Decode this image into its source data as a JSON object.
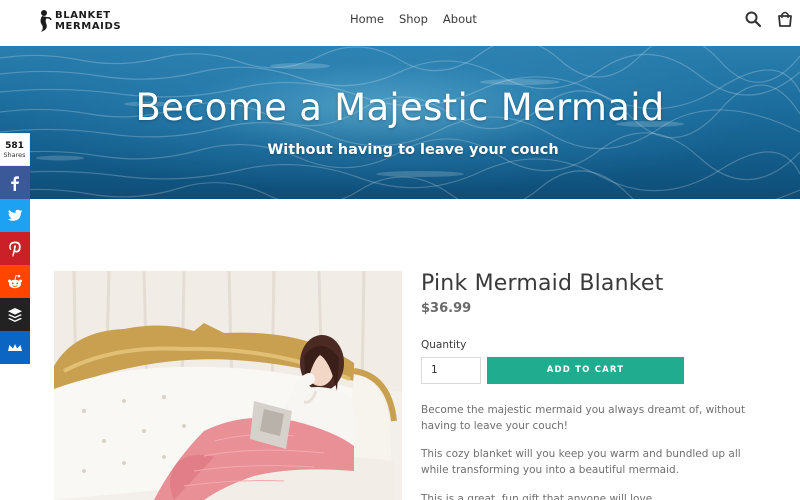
{
  "header": {
    "logo_line1": "BLANKET",
    "logo_line2": "MERMAIDS",
    "nav": [
      "Home",
      "Shop",
      "About"
    ],
    "icons": [
      "search-icon",
      "cart-icon"
    ]
  },
  "hero": {
    "title": "Become a Majestic Mermaid",
    "subtitle": "Without having to leave your couch"
  },
  "share": {
    "count": "581",
    "count_label": "Shares",
    "buttons": [
      {
        "name": "facebook",
        "icon": "facebook-icon",
        "color": "#3b5998"
      },
      {
        "name": "twitter",
        "icon": "twitter-icon",
        "color": "#1da1f2"
      },
      {
        "name": "pinterest",
        "icon": "pinterest-icon",
        "color": "#cb2027"
      },
      {
        "name": "reddit",
        "icon": "reddit-icon",
        "color": "#ff4500"
      },
      {
        "name": "buffer",
        "icon": "buffer-icon",
        "color": "#222222"
      },
      {
        "name": "sumo",
        "icon": "sumo-crown-icon",
        "color": "#0b65c2"
      }
    ]
  },
  "product": {
    "title": "Pink Mermaid Blanket",
    "price": "$36.99",
    "quantity_label": "Quantity",
    "quantity_value": "1",
    "add_to_cart": "ADD TO CART",
    "description": [
      "Become the majestic mermaid you always dreamt of, without having to leave your couch!",
      "This cozy blanket will you keep you warm and bundled up all while transforming you into a beautiful mermaid.",
      "This is a great, fun gift that anyone will love"
    ]
  },
  "colors": {
    "accent": "#20ac8f",
    "hero_blue": "#1d6f9f"
  }
}
